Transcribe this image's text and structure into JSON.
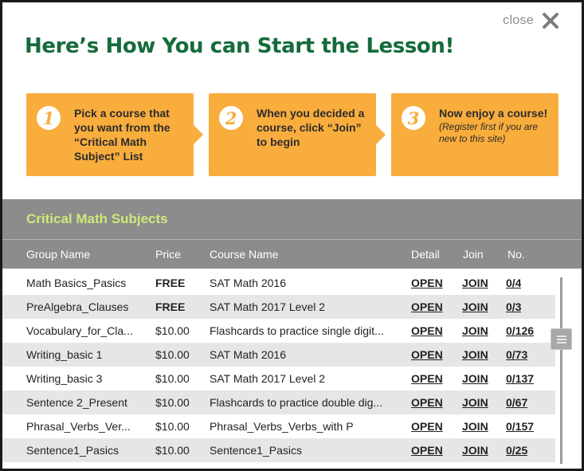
{
  "close": {
    "label": "close"
  },
  "heading": "Here’s How You can Start the Lesson!",
  "steps": [
    {
      "number": "1",
      "text": "Pick a course that you want from the “Critical Math Subject” List",
      "note": ""
    },
    {
      "number": "2",
      "text": "When you decided a course, click “Join” to begin",
      "note": ""
    },
    {
      "number": "3",
      "text": "Now enjoy a course!",
      "note": "(Register first if you are new to this site)"
    }
  ],
  "panel": {
    "title": "Critical Math Subjects",
    "columns": {
      "group": "Group Name",
      "price": "Price",
      "course": "Course Name",
      "detail": "Detail",
      "join": "Join",
      "no": "No."
    },
    "rows": [
      {
        "group": "Math Basics_Pasics",
        "price": "FREE",
        "course": "SAT Math 2016",
        "detail": "OPEN",
        "join": "JOIN",
        "no": "0/4"
      },
      {
        "group": "PreAlgebra_Clauses",
        "price": "FREE",
        "course": "SAT Math 2017 Level 2",
        "detail": "OPEN",
        "join": "JOIN",
        "no": "0/3"
      },
      {
        "group": "Vocabulary_for_Cla...",
        "price": "$10.00",
        "course": "Flashcards to practice single digit...",
        "detail": "OPEN",
        "join": "JOIN",
        "no": "0/126"
      },
      {
        "group": "Writing_basic 1",
        "price": "$10.00",
        "course": "SAT Math 2016",
        "detail": "OPEN",
        "join": "JOIN",
        "no": "0/73"
      },
      {
        "group": "Writing_basic 3",
        "price": "$10.00",
        "course": "SAT Math 2017 Level 2",
        "detail": "OPEN",
        "join": "JOIN",
        "no": "0/137"
      },
      {
        "group": "Sentence 2_Present",
        "price": "$10.00",
        "course": "Flashcards to practice double dig...",
        "detail": "OPEN",
        "join": "JOIN",
        "no": "0/67"
      },
      {
        "group": "Phrasal_Verbs_Ver...",
        "price": "$10.00",
        "course": "Phrasal_Verbs_Verbs_with P",
        "detail": "OPEN",
        "join": "JOIN",
        "no": "0/157"
      },
      {
        "group": "Sentence1_Pasics",
        "price": "$10.00",
        "course": "Sentence1_Pasics",
        "detail": "OPEN",
        "join": "JOIN",
        "no": "0/25"
      }
    ]
  },
  "colors": {
    "heading": "#156b3a",
    "step_bg": "#f9ad3d",
    "panel_bg": "#8c8c8c",
    "panel_title": "#cfe87a",
    "row_alt": "#e6e6e6"
  }
}
